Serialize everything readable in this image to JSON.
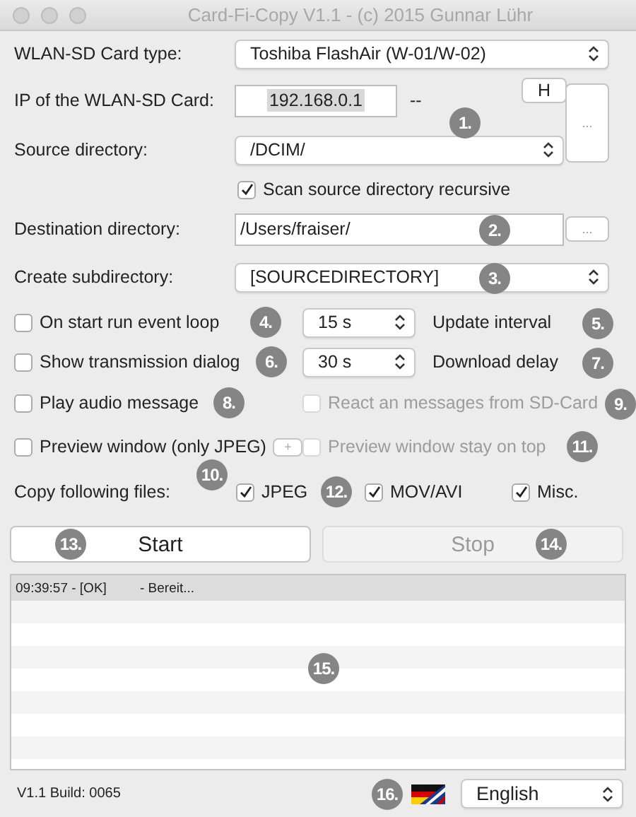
{
  "window": {
    "title": "Card-Fi-Copy V1.1 - (c) 2015 Gunnar Lühr"
  },
  "card_type": {
    "label": "WLAN-SD Card type:",
    "value": "Toshiba FlashAir (W-01/W-02)"
  },
  "ip": {
    "label": "IP of the WLAN-SD Card:",
    "value": "192.168.0.1",
    "status": "--",
    "h_button": "H",
    "browse_button": "..."
  },
  "source": {
    "label": "Source directory:",
    "value": "/DCIM/"
  },
  "scan_recursive": {
    "label": "Scan source directory recursive",
    "checked": true,
    "disabled": false
  },
  "destination": {
    "label": "Destination directory:",
    "value": "/Users/fraiser/",
    "browse_button": "..."
  },
  "subdirectory": {
    "label": "Create subdirectory:",
    "value": "[SOURCEDIRECTORY]"
  },
  "options_left": [
    {
      "label": "On start run event loop",
      "checked": false,
      "disabled": false
    },
    {
      "label": "Show transmission dialog",
      "checked": false,
      "disabled": false
    },
    {
      "label": "Play audio message",
      "checked": false,
      "disabled": false
    },
    {
      "label": "Preview window (only JPEG)",
      "checked": false,
      "disabled": false,
      "button": "+"
    }
  ],
  "options_right": [
    {
      "kind": "spinner",
      "setting": {
        "value": "15 s",
        "label": "Update interval"
      }
    },
    {
      "kind": "spinner",
      "setting": {
        "value": "30 s",
        "label": "Download delay"
      }
    },
    {
      "kind": "checkbox",
      "label": "React an messages from SD-Card",
      "checked": false,
      "disabled": true
    },
    {
      "kind": "checkbox",
      "label": "Preview window stay on top",
      "checked": false,
      "disabled": true
    }
  ],
  "copy_files": {
    "label": "Copy following files:",
    "types": [
      {
        "label": "JPEG",
        "checked": true,
        "disabled": false
      },
      {
        "label": "MOV/AVI",
        "checked": true,
        "disabled": false
      },
      {
        "label": "Misc.",
        "checked": true,
        "disabled": false
      }
    ]
  },
  "buttons": [
    {
      "label": "Start",
      "disabled": false
    },
    {
      "label": "Stop",
      "disabled": true
    }
  ],
  "log": [
    {
      "time": "09:39:57 - [OK]",
      "message": "- Bereit...",
      "selected": true
    }
  ],
  "footer": {
    "build": "V1.1 Build: 0065",
    "language": "English"
  },
  "markers": [
    "1.",
    "2.",
    "3.",
    "4.",
    "5.",
    "6.",
    "7.",
    "8.",
    "9.",
    "10.",
    "11.",
    "12.",
    "13.",
    "14.",
    "15.",
    "16."
  ]
}
